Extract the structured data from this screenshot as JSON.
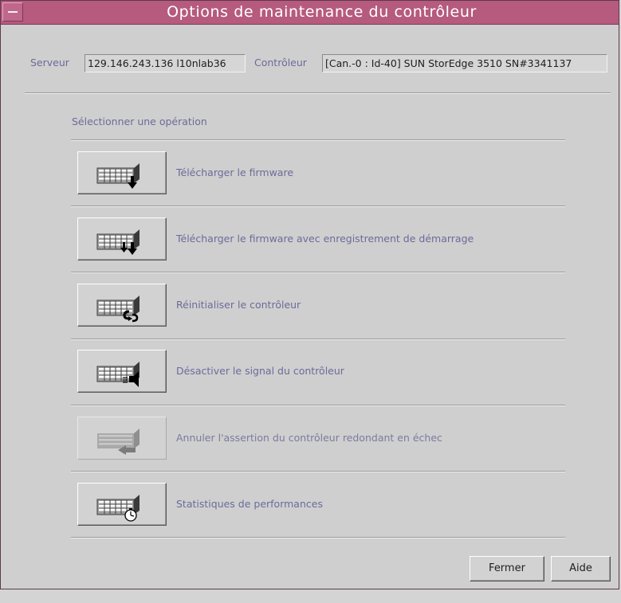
{
  "window": {
    "title": "Options de maintenance du contrôleur"
  },
  "header": {
    "server_label": "Serveur",
    "server_value": "129.146.243.136 l10nlab36",
    "controller_label": "Contrôleur",
    "controller_value": "[Can.-0 : Id-40] SUN StorEdge 3510 SN#3341137"
  },
  "section": {
    "label": "Sélectionner une opération"
  },
  "operations": [
    {
      "label": "Télécharger le firmware",
      "icon": "download-firmware-icon",
      "enabled": true
    },
    {
      "label": "Télécharger le firmware avec enregistrement de démarrage",
      "icon": "download-firmware-bootrecord-icon",
      "enabled": true
    },
    {
      "label": "Réinitialiser le contrôleur",
      "icon": "reset-controller-icon",
      "enabled": true
    },
    {
      "label": "Désactiver le signal du contrôleur",
      "icon": "mute-controller-icon",
      "enabled": true
    },
    {
      "label": "Annuler l'assertion du contrôleur redondant en échec",
      "icon": "deassert-failed-controller-icon",
      "enabled": false
    },
    {
      "label": "Statistiques de performances",
      "icon": "performance-statistics-icon",
      "enabled": true
    }
  ],
  "buttons": {
    "close": "Fermer",
    "help": "Aide"
  },
  "colors": {
    "titlebar": "#b65a7e",
    "background": "#cfcfcf",
    "label_text": "#6b6b9b"
  }
}
